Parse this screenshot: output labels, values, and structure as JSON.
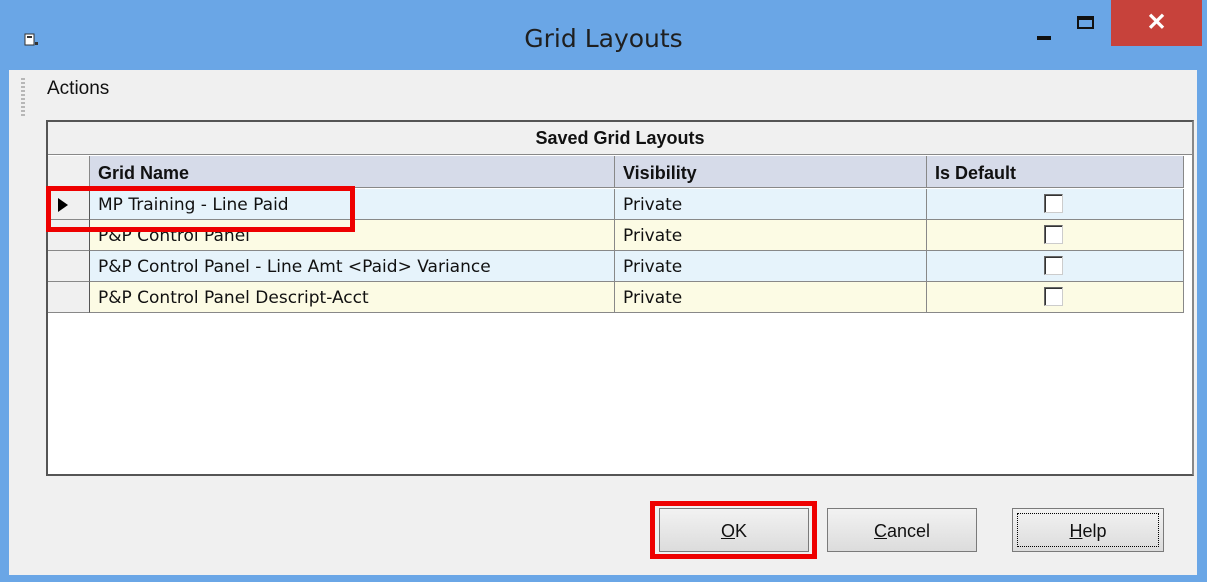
{
  "window": {
    "title": "Grid Layouts",
    "close_glyph": "✕"
  },
  "menu": {
    "actions_label": "Actions"
  },
  "grid": {
    "caption": "Saved Grid Layouts",
    "columns": [
      "Grid Name",
      "Visibility",
      "Is Default"
    ],
    "rows": [
      {
        "name": "MP Training - Line Paid",
        "visibility": "Private",
        "is_default": false,
        "selected": true
      },
      {
        "name": "P&P Control Panel",
        "visibility": "Private",
        "is_default": false,
        "selected": false
      },
      {
        "name": "P&P Control Panel - Line Amt <Paid> Variance",
        "visibility": "Private",
        "is_default": false,
        "selected": false
      },
      {
        "name": "P&P Control Panel Descript-Acct",
        "visibility": "Private",
        "is_default": false,
        "selected": false
      }
    ]
  },
  "buttons": {
    "ok_mnemonic": "O",
    "ok_rest": "K",
    "cancel_mnemonic": "C",
    "cancel_rest": "ancel",
    "help_mnemonic": "H",
    "help_rest": "elp"
  },
  "colors": {
    "titlebar": "#6aa6e6",
    "close_button": "#c7423b",
    "row_even": "#e6f3fb",
    "row_odd": "#fcfbe4",
    "highlight": "#e00000"
  }
}
